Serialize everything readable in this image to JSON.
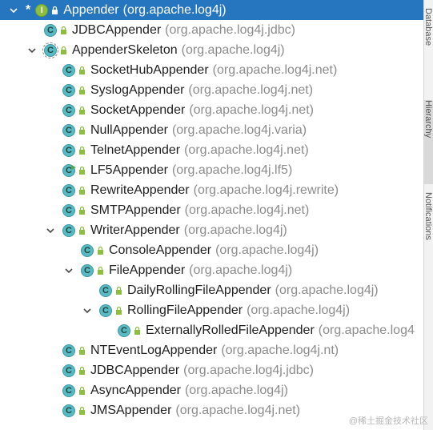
{
  "tree": {
    "rows": [
      {
        "name": "Appender",
        "pkg": "(org.apache.log4j)",
        "kind": "iface",
        "badge_letter": "I",
        "star": "*",
        "expanded": true,
        "selected": true,
        "depth": 0
      },
      {
        "name": "JDBCAppender",
        "pkg": "(org.apache.log4j.jdbc)",
        "kind": "class",
        "badge_letter": "C",
        "depth": 1
      },
      {
        "name": "AppenderSkeleton",
        "pkg": "(org.apache.log4j)",
        "kind": "abstract",
        "badge_letter": "C",
        "expanded": true,
        "depth": 1
      },
      {
        "name": "SocketHubAppender",
        "pkg": "(org.apache.log4j.net)",
        "kind": "class",
        "badge_letter": "C",
        "depth": 2
      },
      {
        "name": "SyslogAppender",
        "pkg": "(org.apache.log4j.net)",
        "kind": "class",
        "badge_letter": "C",
        "depth": 2
      },
      {
        "name": "SocketAppender",
        "pkg": "(org.apache.log4j.net)",
        "kind": "class",
        "badge_letter": "C",
        "depth": 2
      },
      {
        "name": "NullAppender",
        "pkg": "(org.apache.log4j.varia)",
        "kind": "class",
        "badge_letter": "C",
        "depth": 2
      },
      {
        "name": "TelnetAppender",
        "pkg": "(org.apache.log4j.net)",
        "kind": "class",
        "badge_letter": "C",
        "depth": 2
      },
      {
        "name": "LF5Appender",
        "pkg": "(org.apache.log4j.lf5)",
        "kind": "class",
        "badge_letter": "C",
        "flag": true,
        "depth": 2
      },
      {
        "name": "RewriteAppender",
        "pkg": "(org.apache.log4j.rewrite)",
        "kind": "class",
        "badge_letter": "C",
        "depth": 2
      },
      {
        "name": "SMTPAppender",
        "pkg": "(org.apache.log4j.net)",
        "kind": "class",
        "badge_letter": "C",
        "depth": 2
      },
      {
        "name": "WriterAppender",
        "pkg": "(org.apache.log4j)",
        "kind": "class",
        "badge_letter": "C",
        "expanded": true,
        "depth": 2
      },
      {
        "name": "ConsoleAppender",
        "pkg": "(org.apache.log4j)",
        "kind": "class",
        "badge_letter": "C",
        "depth": 3
      },
      {
        "name": "FileAppender",
        "pkg": "(org.apache.log4j)",
        "kind": "class",
        "badge_letter": "C",
        "expanded": true,
        "depth": 3
      },
      {
        "name": "DailyRollingFileAppender",
        "pkg": "(org.apache.log4j)",
        "kind": "class",
        "badge_letter": "C",
        "depth": 4
      },
      {
        "name": "RollingFileAppender",
        "pkg": "(org.apache.log4j)",
        "kind": "class",
        "badge_letter": "C",
        "expanded": true,
        "depth": 4
      },
      {
        "name": "ExternallyRolledFileAppender",
        "pkg": "(org.apache.log4",
        "kind": "class",
        "badge_letter": "C",
        "depth": 5
      },
      {
        "name": "NTEventLogAppender",
        "pkg": "(org.apache.log4j.nt)",
        "kind": "class",
        "badge_letter": "C",
        "depth": 2
      },
      {
        "name": "JDBCAppender",
        "pkg": "(org.apache.log4j.jdbc)",
        "kind": "class",
        "badge_letter": "C",
        "depth": 2
      },
      {
        "name": "AsyncAppender",
        "pkg": "(org.apache.log4j)",
        "kind": "class",
        "badge_letter": "C",
        "depth": 2
      },
      {
        "name": "JMSAppender",
        "pkg": "(org.apache.log4j.net)",
        "kind": "class",
        "badge_letter": "C",
        "depth": 2
      }
    ]
  },
  "sidebar": {
    "tabs": [
      {
        "label": "Database"
      },
      {
        "label": "Hierarchy",
        "active": true
      },
      {
        "label": "Notifications"
      }
    ]
  },
  "watermark": "@稀土掘金技术社区",
  "colors": {
    "selection": "#2675bf",
    "package_text": "#8c8c8c",
    "class_badge": "#56b9c3",
    "interface_badge": "#8cbf3f",
    "lock": "#8cbf3f"
  }
}
